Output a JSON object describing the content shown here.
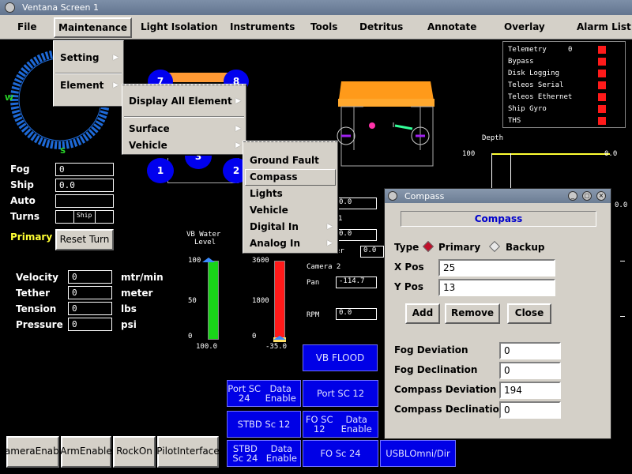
{
  "window": {
    "title": "Ventana Screen 1"
  },
  "menubar": {
    "items": [
      "File",
      "Maintenance",
      "Light Isolation",
      "Instruments",
      "Tools",
      "Detritus",
      "Annotate",
      "Overlay",
      "Alarm List"
    ]
  },
  "maintenance_menu": {
    "items": [
      "Setting",
      "Element"
    ]
  },
  "element_menu": {
    "items": [
      "Display All Element",
      "Surface",
      "Vehicle"
    ]
  },
  "vehicle_menu": {
    "items": [
      "Ground Fault",
      "Compass",
      "Lights",
      "Vehicle",
      "Digital In",
      "Analog In"
    ]
  },
  "compass_rose": {
    "west": "W",
    "south": "S"
  },
  "left_panel": {
    "fog_label": "Fog",
    "fog_value": "0",
    "ship_label": "Ship",
    "ship_value": "0.0",
    "auto_label": "Auto",
    "auto_value": "",
    "turns_label": "Turns",
    "turns_ship": "Ship",
    "primary_label": "Primary",
    "reset_turn": "Reset Turn"
  },
  "vehicle_stats": [
    {
      "label": "Velocity",
      "value": "0",
      "unit": "mtr/min"
    },
    {
      "label": "Tether",
      "value": "0",
      "unit": "meter"
    },
    {
      "label": "Tension",
      "value": "0",
      "unit": "lbs"
    },
    {
      "label": "Pressure",
      "value": "0",
      "unit": "psi"
    }
  ],
  "thrusters": [
    "7",
    "8",
    "1",
    "3",
    "2"
  ],
  "alarms": {
    "telemetry_value": "0",
    "items": [
      "Telemetry",
      "Bypass",
      "Disk Logging",
      "Teleos Serial",
      "Teleos Ethernet",
      "Ship Gyro",
      "THS"
    ],
    "status_color": "#ff1a1a"
  },
  "depth": {
    "title": "Depth",
    "tick_top": "100",
    "side_value_1": "0.0",
    "side_value_2": "0.0"
  },
  "gauges": {
    "vb_title_1": "VB Water",
    "vb_title_2": "Level",
    "vb_ticks": [
      "100",
      "50",
      "0"
    ],
    "vb_value": "100.0",
    "vb_level": 1.0,
    "vb_color": "#19d419",
    "red_ticks": [
      "3600",
      "1800",
      "0"
    ],
    "red_value": "-35.0",
    "red_level": 1.0,
    "red_color": "#ff1a1a"
  },
  "camera": {
    "field_values": [
      "0.0",
      "0.0",
      "0.0"
    ],
    "fragment_1": "1",
    "fragment_er": "er",
    "title": "Camera 2",
    "pan_label": "Pan",
    "pan_value": "-114.7",
    "rpm_label": "RPM",
    "rpm_value": "0.0"
  },
  "vb_flood": "VB FLOOD",
  "bottom_buttons": [
    {
      "line1": "Camera",
      "line2": "Enable"
    },
    {
      "line1": "Arm",
      "line2": "Enable"
    },
    {
      "line1": "Rock",
      "line2": "On"
    },
    {
      "line1": "Pilot",
      "line2": "Interface"
    }
  ],
  "blue_buttons": [
    {
      "line1": "Port SC 24",
      "line2": "Data Enable"
    },
    {
      "line1": "Port SC 12",
      "line2": ""
    },
    {
      "line1": "STBD Sc 12",
      "line2": ""
    },
    {
      "line1": "FO SC 12",
      "line2": "Data Enable"
    },
    {
      "line1": "STBD Sc 24",
      "line2": "Data Enable"
    },
    {
      "line1": "FO Sc 24",
      "line2": ""
    },
    {
      "line1": "USBL",
      "line2": "Omni/Dir"
    }
  ],
  "compass_dialog": {
    "title": "Compass",
    "banner": "Compass",
    "type_label": "Type",
    "primary": "Primary",
    "backup": "Backup",
    "xpos_label": "X Pos",
    "xpos_value": "25",
    "ypos_label": "Y Pos",
    "ypos_value": "13",
    "add": "Add",
    "remove": "Remove",
    "close": "Close",
    "fields": [
      {
        "label": "Fog Deviation",
        "value": "0"
      },
      {
        "label": "Fog Declination",
        "value": "0"
      },
      {
        "label": "Compass Deviation",
        "value": "194"
      },
      {
        "label": "Compass Declination",
        "value": "0"
      }
    ]
  }
}
